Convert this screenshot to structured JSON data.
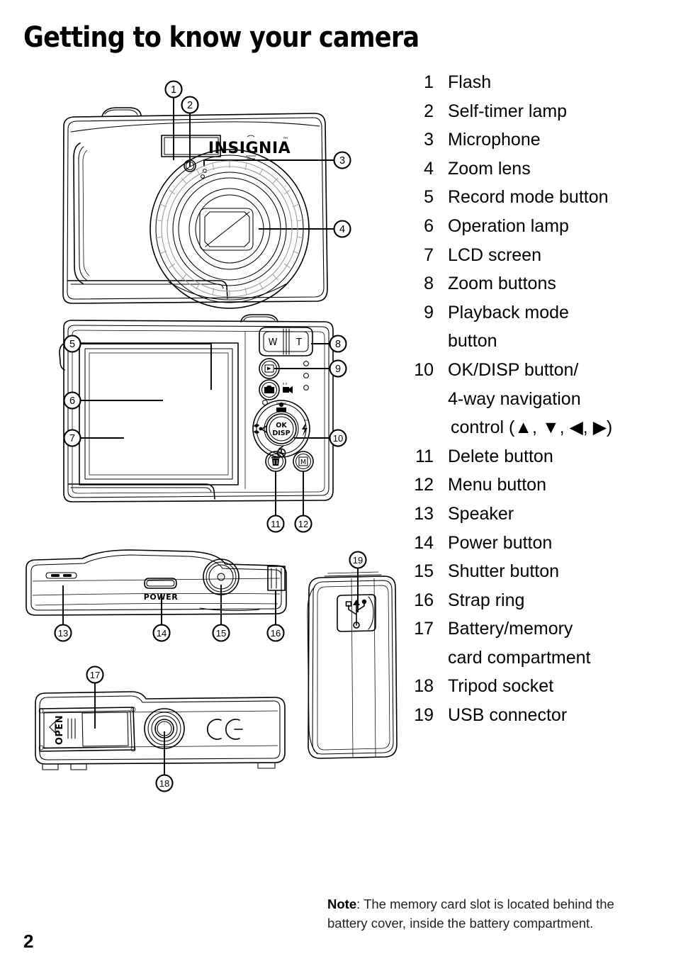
{
  "page": {
    "title": "Getting to know your camera",
    "number": "2"
  },
  "legend": {
    "items": [
      {
        "num": "1",
        "label": "Flash"
      },
      {
        "num": "2",
        "label": "Self-timer lamp"
      },
      {
        "num": "3",
        "label": "Microphone"
      },
      {
        "num": "4",
        "label": "Zoom lens"
      },
      {
        "num": "5",
        "label": "Record mode button"
      },
      {
        "num": "6",
        "label": "Operation lamp"
      },
      {
        "num": "7",
        "label": "LCD screen"
      },
      {
        "num": "8",
        "label": "Zoom buttons"
      },
      {
        "num": "9",
        "label": "Playback mode",
        "cont": [
          "button"
        ]
      },
      {
        "num": "10",
        "label": "OK/DISP button/",
        "cont": [
          "4-way navigation",
          "control (▲, ▼, ◀, ▶)"
        ]
      },
      {
        "num": "11",
        "label": "Delete button"
      },
      {
        "num": "12",
        "label": "Menu button"
      },
      {
        "num": "13",
        "label": "Speaker"
      },
      {
        "num": "14",
        "label": "Power button"
      },
      {
        "num": "15",
        "label": "Shutter button"
      },
      {
        "num": "16",
        "label": "Strap ring"
      },
      {
        "num": "17",
        "label": "Battery/memory",
        "cont": [
          "card compartment"
        ]
      },
      {
        "num": "18",
        "label": "Tripod socket"
      },
      {
        "num": "19",
        "label": "USB connector"
      }
    ]
  },
  "note": {
    "bold_prefix": "Note",
    "text": ": The memory card slot is located behind the battery cover, inside the battery compartment."
  },
  "figures": {
    "front": {
      "name": "camera-front-view",
      "brand": "INSIGNIA",
      "callouts": [
        "1",
        "2",
        "3",
        "4"
      ]
    },
    "back": {
      "name": "camera-back-view",
      "zoom_wide_label": "W",
      "zoom_tele_label": "T",
      "ok_disp_line1": "OK",
      "ok_disp_line2": "DISP",
      "menu_label": "M",
      "callouts": [
        "5",
        "6",
        "7",
        "8",
        "9",
        "10",
        "11",
        "12"
      ]
    },
    "top": {
      "name": "camera-top-view",
      "power_label": "POWER",
      "callouts": [
        "13",
        "14",
        "15",
        "16"
      ]
    },
    "bottom": {
      "name": "camera-bottom-view",
      "open_label": "OPEN",
      "ce_label": "CE",
      "callouts": [
        "17",
        "18"
      ]
    },
    "side": {
      "name": "camera-side-view",
      "callouts": [
        "19"
      ]
    }
  },
  "colors": {
    "ink": "#000000",
    "note_text": "#231f20",
    "shading": "#9a9a9a"
  }
}
